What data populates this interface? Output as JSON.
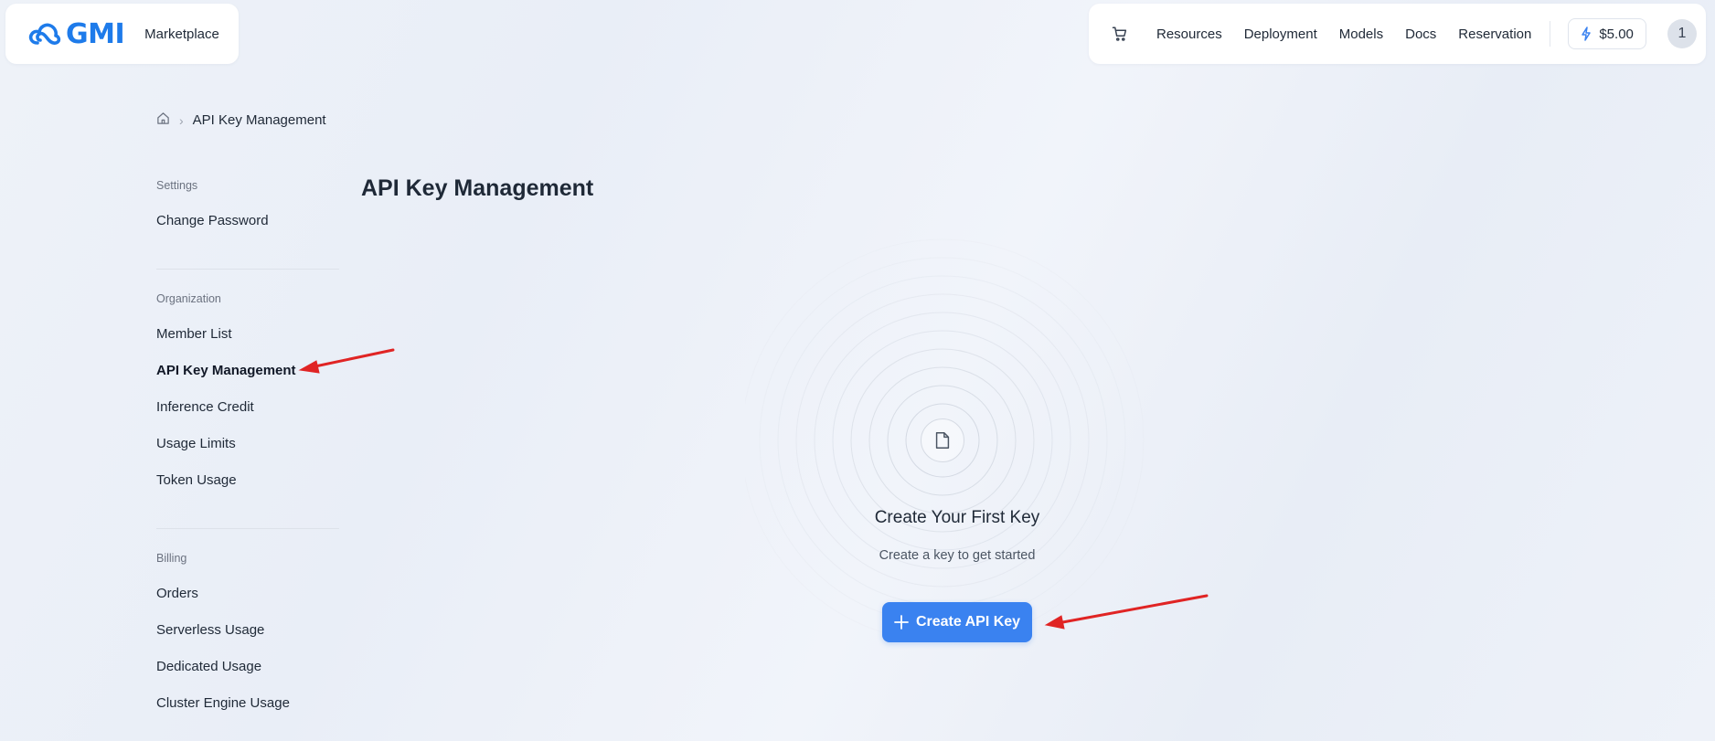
{
  "header": {
    "logo_text": "GMI",
    "marketplace_label": "Marketplace",
    "nav": [
      "Resources",
      "Deployment",
      "Models",
      "Docs",
      "Reservation"
    ],
    "balance": "$5.00",
    "avatar_initial": "1",
    "cart_icon": "cart-icon",
    "balance_icon": "lightning-icon"
  },
  "breadcrumb": {
    "home_icon": "home-icon",
    "current": "API Key Management"
  },
  "sidebar": {
    "settings": {
      "label": "Settings",
      "items": [
        "Change Password"
      ]
    },
    "organization": {
      "label": "Organization",
      "items": [
        "Member List",
        "API Key Management",
        "Inference Credit",
        "Usage Limits",
        "Token Usage"
      ],
      "active": "API Key Management"
    },
    "billing": {
      "label": "Billing",
      "items": [
        "Orders",
        "Serverless Usage",
        "Dedicated Usage",
        "Cluster Engine Usage"
      ]
    }
  },
  "main": {
    "title": "API Key Management",
    "empty_state": {
      "icon": "document-icon",
      "title": "Create Your First Key",
      "subtitle": "Create a key to get started",
      "button_label": "Create API Key",
      "button_icon": "plus-icon"
    }
  },
  "colors": {
    "brand": "#1e7bea",
    "primary_button": "#3a82f0",
    "annotation_arrow": "#e02424"
  }
}
